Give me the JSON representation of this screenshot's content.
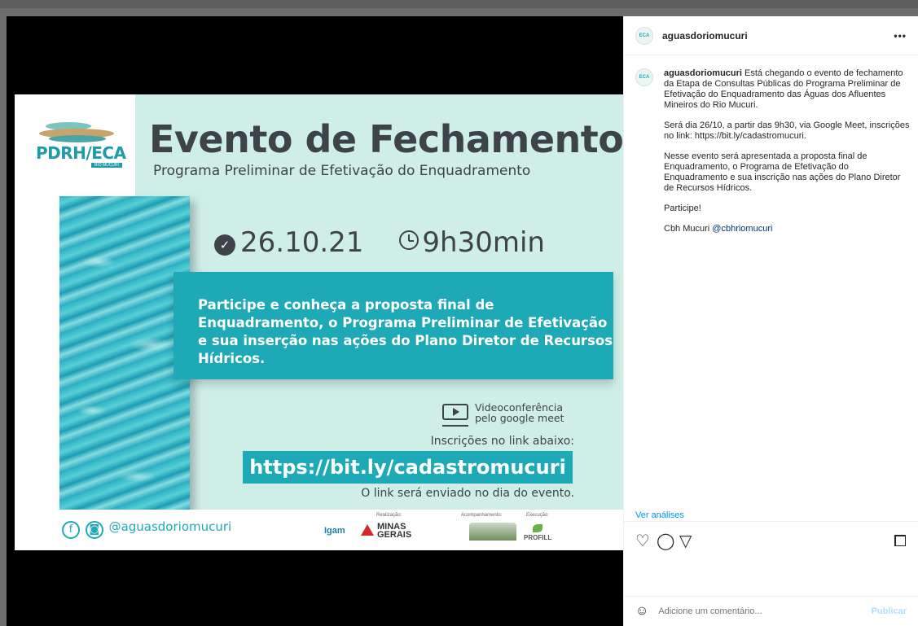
{
  "post": {
    "username": "aguasdoriomucuri",
    "more_label": "•••",
    "caption": {
      "username": "aguasdoriomucuri",
      "p1": " Está chegando o evento de fechamento da Etapa de Consultas Públicas do Programa Preliminar de Efetivação do Enquadramento das Águas dos Afluentes Mineiros do Rio Mucuri.",
      "p2": "Será dia 26/10, a partir das 9h30, via Google Meet, inscrições no link: https://bit.ly/cadastromucuri.",
      "p3": "Nesse evento será apresentada a proposta final de Enquadramento, o Programa de Efetivação do Enquadramento e sua inscrição nas ações do Plano Diretor de Recursos Hídricos.",
      "p4": "Participe!",
      "p5_text": "Cbh Mucuri ",
      "p5_mention": "@cbhriomucuri"
    },
    "insights_label": "Ver análises",
    "comment_placeholder": "Adicione um comentário...",
    "publish_label": "Publicar"
  },
  "poster": {
    "logo_text": "PDRH/ECA",
    "logo_sub": "RIO MUCURI",
    "title": "Evento de Fechamento",
    "subtitle": "Programa Preliminar de Efetivação do Enquadramento",
    "date": "26.10.21",
    "time": "9h30min",
    "box_text": "Participe e conheça a proposta final de Enquadramento, o Programa Preliminar de Efetivação e sua inserção nas ações do Plano Diretor de Recursos Hídricos.",
    "video_line1": "Videoconferência",
    "video_line2": "pelo google meet",
    "inscricoes": "Inscrições no link abaixo:",
    "link": "https://bit.ly/cadastromucuri",
    "sent_note": "O link será enviado no dia do evento.",
    "social_handle": "@aguasdoriomucuri",
    "realizacao": "Realização:",
    "acompanhamento": "Acompanhamento:",
    "execucao": "Execução:",
    "igam": "Igam",
    "minas1": "MINAS",
    "minas2": "GERAIS",
    "profill": "PROFILL"
  },
  "icons": {
    "avatar": "profile-avatar",
    "heart": "heart-icon",
    "comment": "comment-icon",
    "share": "share-icon",
    "save": "bookmark-icon",
    "emoji": "emoji-icon"
  },
  "colors": {
    "teal": "#1ea9b7",
    "link_blue": "#0095f6",
    "text": "#262626"
  }
}
